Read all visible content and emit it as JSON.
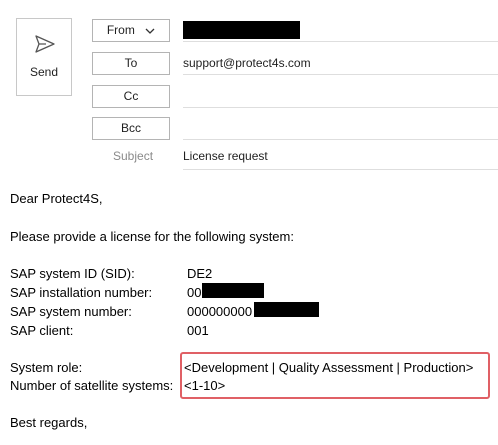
{
  "compose": {
    "send_label": "Send",
    "from_label": "From",
    "to_label": "To",
    "cc_label": "Cc",
    "bcc_label": "Bcc",
    "subject_label": "Subject",
    "to_value": "support@protect4s.com",
    "subject_value": "License request",
    "icons": {
      "send": "send-icon",
      "from_dropdown": "chevron-down-icon"
    }
  },
  "body": {
    "greeting": "Dear Protect4S,",
    "intro": "Please provide a license for the following system:",
    "fields": [
      {
        "label": "SAP system ID (SID):",
        "value": "DE2"
      },
      {
        "label": "SAP installation number:",
        "value": "00"
      },
      {
        "label": "SAP system number:",
        "value": "000000000"
      },
      {
        "label": "SAP client:",
        "value": "001"
      }
    ],
    "system_role_label": "System role:",
    "system_role_value": "<Development | Quality Assessment | Production>",
    "satellite_label": "Number of satellite systems:",
    "satellite_value": "<1-10>",
    "closing": "Best regards,"
  },
  "colors": {
    "highlight_border": "#e06065",
    "redaction": "#000000"
  }
}
